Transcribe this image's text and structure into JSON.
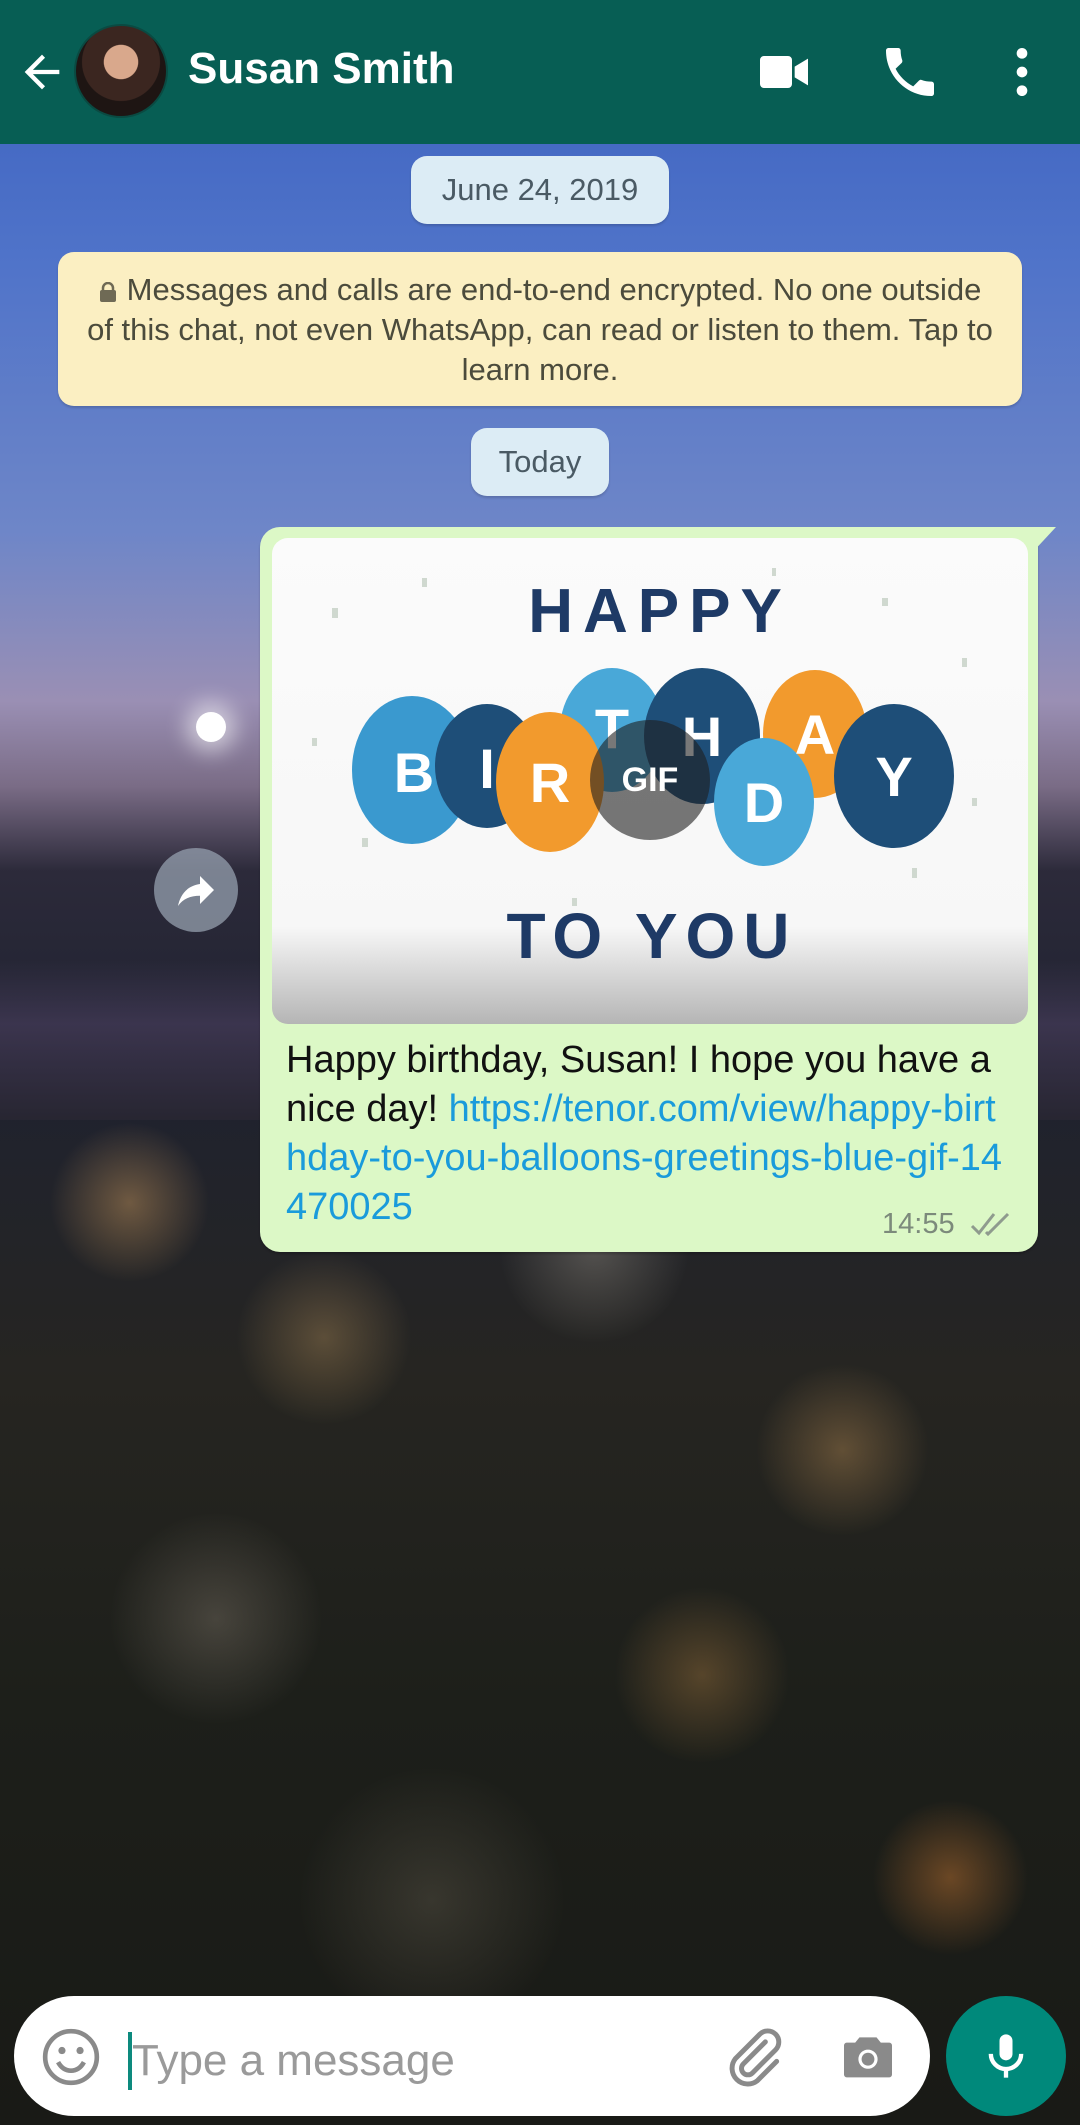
{
  "header": {
    "contact_name": "Susan Smith",
    "background_color": "#075e54",
    "icons": [
      "back-arrow-icon",
      "avatar",
      "video-call-icon",
      "phone-icon",
      "more-options-icon"
    ]
  },
  "chat": {
    "date_chip_1": "June 24, 2019",
    "encryption_notice": "Messages and calls are end-to-end encrypted. No one outside of this chat, not even WhatsApp, can read or listen to them. Tap to learn more.",
    "date_chip_2": "Today",
    "message": {
      "gif_badge": "GIF",
      "gif_line_1": "HAPPY",
      "gif_letters": [
        "B",
        "I",
        "R",
        "T",
        "H",
        "D",
        "A",
        "Y"
      ],
      "gif_line_3": "TO YOU",
      "text": "Happy birthday, Susan! I hope you have a nice day! ",
      "link": "https://tenor.com/view/happy-birthday-to-you-balloons-greetings-blue-gif-14470025",
      "time": "14:55",
      "status": "delivered",
      "bubble_color": "#dcf8c6",
      "link_color": "#1a9bdb"
    }
  },
  "input": {
    "placeholder": "Type a message",
    "icons": [
      "emoji-icon",
      "attach-icon",
      "camera-icon",
      "mic-icon"
    ],
    "mic_button_color": "#00897b"
  }
}
